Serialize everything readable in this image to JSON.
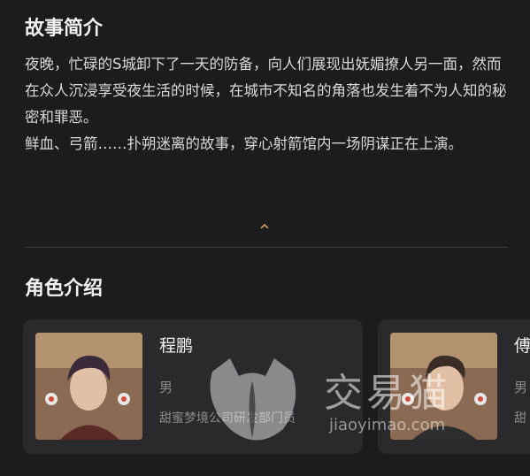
{
  "story": {
    "title": "故事简介",
    "paragraph1": "夜晚，忙碌的S城卸下了一天的防备，向人们展现出妩媚撩人另一面，然而在众人沉浸享受夜生活的时候，在城市不知名的角落也发生着不为人知的秘密和罪恶。",
    "paragraph2": "鲜血、弓箭……扑朔迷离的故事，穿心射箭馆内一场阴谋正在上演。",
    "collapse_icon": "chevron-up-icon"
  },
  "characters": {
    "title": "角色介绍",
    "items": [
      {
        "name": "程鹏",
        "gender": "男",
        "desc": "甜蜜梦境公司研发部门员"
      },
      {
        "name": "傅",
        "gender": "男",
        "desc": "甜"
      }
    ]
  },
  "watermark": {
    "text": "交易猫",
    "url": "jiaoyimao.com"
  },
  "colors": {
    "background": "#1c1c1e",
    "card": "#2a2a2c",
    "accent": "#c9a15a"
  }
}
